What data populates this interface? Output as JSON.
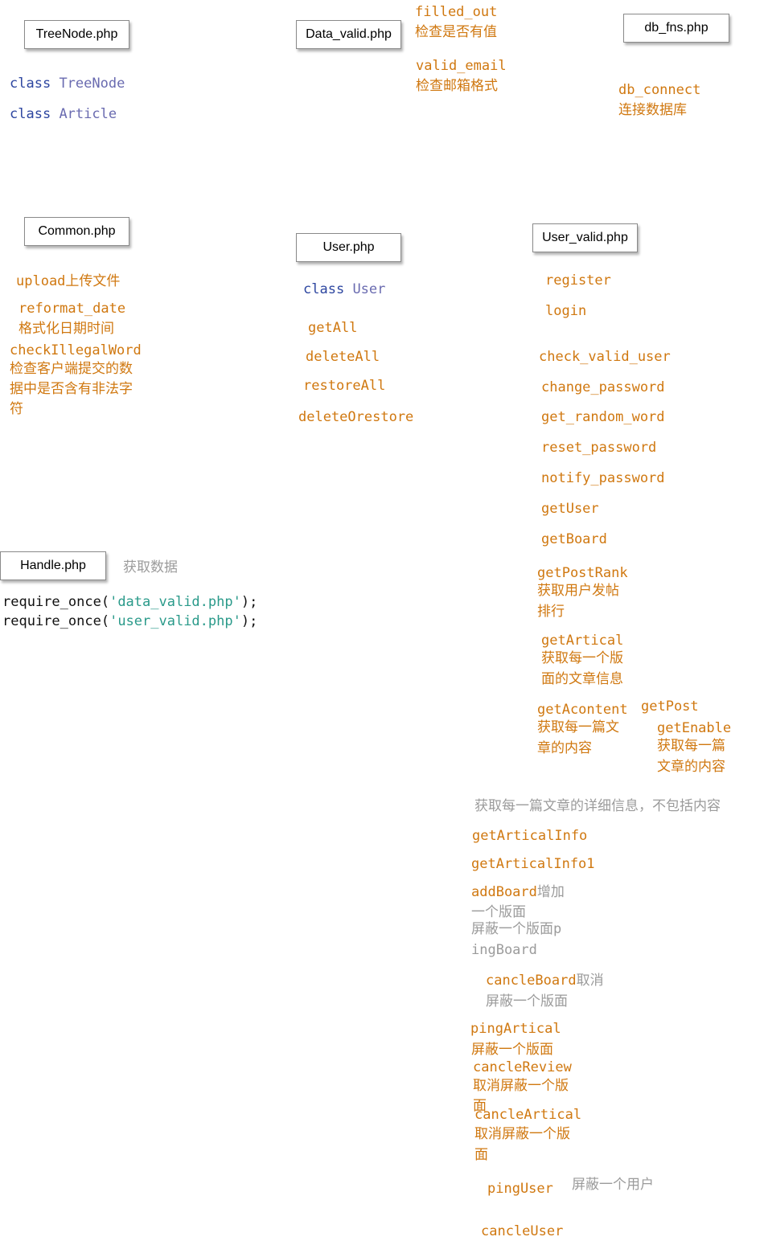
{
  "files": {
    "treenode": "TreeNode.php",
    "data_valid": "Data_valid.php",
    "db_fns": "db_fns.php",
    "common": "Common.php",
    "user": "User.php",
    "user_valid": "User_valid.php",
    "handle": "Handle.php"
  },
  "treenode_section": {
    "kw": "class",
    "c1": "TreeNode",
    "c2": "Article"
  },
  "data_valid_section": {
    "f1": "filled_out",
    "d1": "检查是否有值",
    "f2": "valid_email",
    "d2": "检查邮箱格式"
  },
  "db_section": {
    "f1": "db_connect",
    "d1": "连接数据库"
  },
  "common_section": {
    "f1": "upload",
    "d1": "上传文件",
    "f2": "reformat_date",
    "d2": "格式化日期时间",
    "f3": "checkIllegalWord",
    "d3a": "检查客户端提交的数",
    "d3b": "据中是否含有非法字",
    "d3c": "符"
  },
  "user_section": {
    "kw": "class",
    "cls": "User",
    "m1": "getAll",
    "m2": "deleteAll",
    "m3": "restoreAll",
    "m4": "deleteOrestore"
  },
  "user_valid_section": {
    "m1": "register",
    "m2": "login",
    "m3": "check_valid_user",
    "m4": "change_password",
    "m5": "get_random_word",
    "m6": "reset_password",
    "m7": "notify_password",
    "m8": "getUser",
    "m9": "getBoard",
    "m10": "getPostRank",
    "d10a": "获取用户发帖",
    "d10b": "排行",
    "m11": "getArtical",
    "d11a": "获取每一个版",
    "d11b": "面的文章信息",
    "m12": "getAcontent",
    "d12a": "获取每一篇文",
    "d12b": "章的内容",
    "m13": "getPost",
    "m14": "getEnable",
    "d14a": "获取每一篇",
    "d14b": "文章的内容",
    "note": "获取每一篇文章的详细信息，不包括内容",
    "m15": "getArticalInfo",
    "m16": "getArticalInfo1",
    "m17": "addBoard",
    "d17a": "增加",
    "d17b": "一个版面",
    "d18a": "屏蔽一个版面",
    "d18p": "p",
    "m18b": "ingBoard",
    "m19": "cancleBoard",
    "d19a": "取消",
    "d19b": "屏蔽一个版面",
    "m20": "pingArtical",
    "d20": "屏蔽一个版面",
    "m21": "cancleReview",
    "d21a": "取消屏蔽一个版",
    "d21b": "面",
    "m22": "cancleArtical",
    "d22a": "取消屏蔽一个版",
    "d22b": "面",
    "m23": "pingUser",
    "d23": "屏蔽一个用户",
    "m24": "cancleUser"
  },
  "handle_section": {
    "note": "获取数据",
    "fn": "require_once",
    "open": "(",
    "arg1": "'data_valid.php'",
    "arg2": "'user_valid.php'",
    "close": ");"
  }
}
